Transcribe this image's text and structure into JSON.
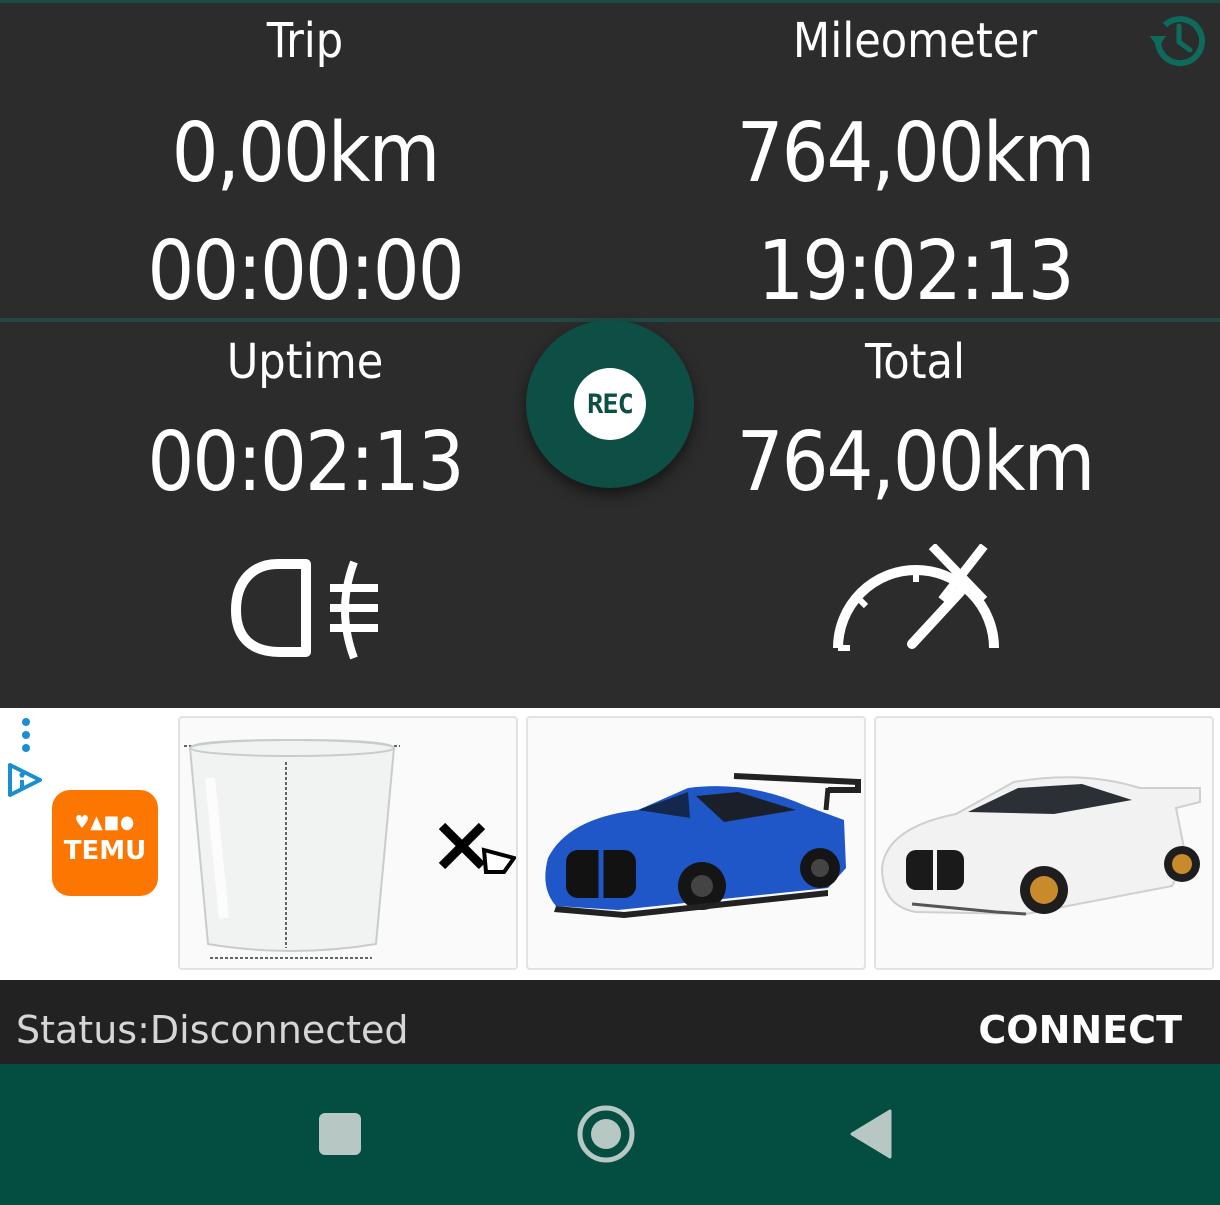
{
  "top": {
    "trip": {
      "label": "Trip",
      "distance": "0,00km",
      "time": "00:00:00"
    },
    "mileometer": {
      "label": "Mileometer",
      "distance": "764,00km",
      "time": "19:02:13"
    },
    "history_icon": "history-icon"
  },
  "middle": {
    "uptime": {
      "label": "Uptime",
      "value": "00:02:13"
    },
    "total": {
      "label": "Total",
      "value": "764,00km"
    },
    "rec_button": {
      "label": "REC"
    },
    "fog_light_icon": "fog-light-icon",
    "speedometer_off_icon": "speedometer-off-icon"
  },
  "ad": {
    "brand": "TEMU",
    "cards": [
      "plastic-cup",
      "blue-model-car",
      "white-model-car"
    ]
  },
  "status": {
    "text": "Status:Disconnected",
    "connect_label": "CONNECT"
  },
  "colors": {
    "accent": "#044e41",
    "rec": "#0d4f44",
    "background": "#2c2c2c",
    "temu": "#fb7701"
  }
}
